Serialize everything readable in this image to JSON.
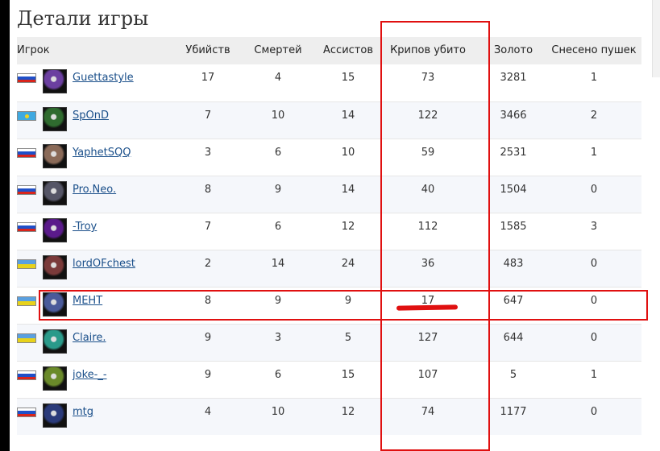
{
  "title": "Детали игры",
  "columns": [
    "Игрок",
    "Убийств",
    "Смертей",
    "Ассистов",
    "Крипов убито",
    "Золото",
    "Снесено пушек"
  ],
  "rows": [
    {
      "flag": "ru",
      "avatar_color": "#6b3fa0",
      "name": "Guettastyle",
      "kills": "17",
      "deaths": "4",
      "assists": "15",
      "creeps": "73",
      "gold": "3281",
      "towers": "1"
    },
    {
      "flag": "kz",
      "avatar_color": "#2f6b2f",
      "name": "SpOnD",
      "kills": "7",
      "deaths": "10",
      "assists": "14",
      "creeps": "122",
      "gold": "3466",
      "towers": "2"
    },
    {
      "flag": "ru",
      "avatar_color": "#8a6a58",
      "name": "YaphetSQQ",
      "kills": "3",
      "deaths": "6",
      "assists": "10",
      "creeps": "59",
      "gold": "2531",
      "towers": "1"
    },
    {
      "flag": "ru",
      "avatar_color": "#555566",
      "name": "Pro.Neo.",
      "kills": "8",
      "deaths": "9",
      "assists": "14",
      "creeps": "40",
      "gold": "1504",
      "towers": "0"
    },
    {
      "flag": "ru",
      "avatar_color": "#5a1a8a",
      "name": "-Troy",
      "kills": "7",
      "deaths": "6",
      "assists": "12",
      "creeps": "112",
      "gold": "1585",
      "towers": "3"
    },
    {
      "flag": "ua",
      "avatar_color": "#7a3a3a",
      "name": "lordOFchest",
      "kills": "2",
      "deaths": "14",
      "assists": "24",
      "creeps": "36",
      "gold": "483",
      "towers": "0"
    },
    {
      "flag": "ua",
      "avatar_color": "#4a5a9a",
      "name": "МЕНТ",
      "kills": "8",
      "deaths": "9",
      "assists": "9",
      "creeps": "17",
      "gold": "647",
      "towers": "0"
    },
    {
      "flag": "ua",
      "avatar_color": "#2a9a8a",
      "name": "Claire.",
      "kills": "9",
      "deaths": "3",
      "assists": "5",
      "creeps": "127",
      "gold": "644",
      "towers": "0"
    },
    {
      "flag": "ru",
      "avatar_color": "#6a8a2a",
      "name": "joke-_-",
      "kills": "9",
      "deaths": "6",
      "assists": "15",
      "creeps": "107",
      "gold": "5",
      "towers": "1"
    },
    {
      "flag": "ru",
      "avatar_color": "#2a3a7a",
      "name": "mtg",
      "kills": "4",
      "deaths": "10",
      "assists": "12",
      "creeps": "74",
      "gold": "1177",
      "towers": "0"
    }
  ],
  "colors": {
    "highlight": "#e01010",
    "link": "#1a4f8a",
    "header_bg": "#eeeeee"
  }
}
